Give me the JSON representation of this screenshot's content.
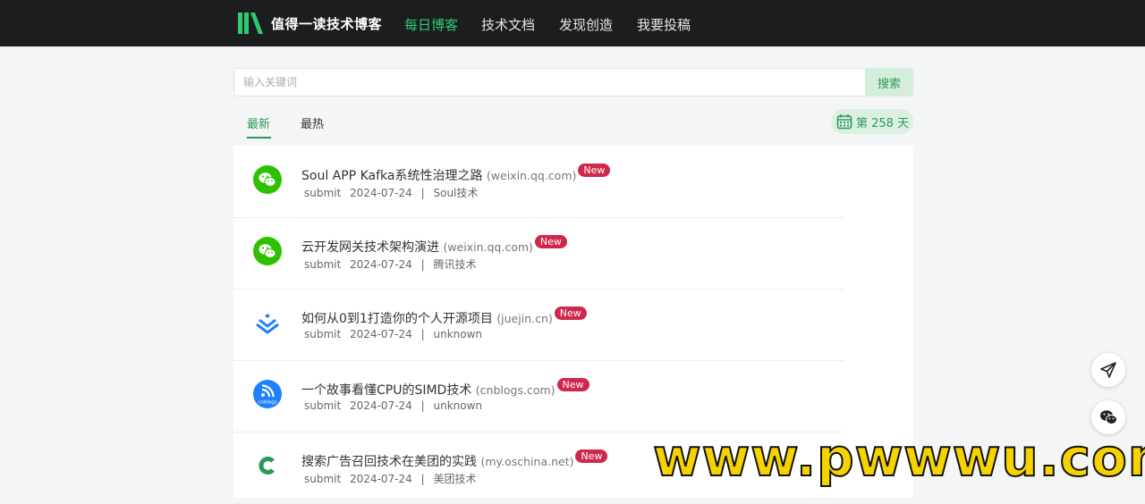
{
  "header": {
    "brand": "值得一读技术博客",
    "nav": [
      {
        "label": "每日博客",
        "active": true
      },
      {
        "label": "技术文档",
        "active": false
      },
      {
        "label": "发现创造",
        "active": false
      },
      {
        "label": "我要投稿",
        "active": false
      }
    ]
  },
  "search": {
    "placeholder": "输入关键词",
    "value": "",
    "button_label": "搜索"
  },
  "tabs": [
    {
      "label": "最新",
      "active": true
    },
    {
      "label": "最热",
      "active": false
    }
  ],
  "day_counter": "第 258 天",
  "articles": [
    {
      "icon": "wechat-icon",
      "title": "Soul APP Kafka系统性治理之路",
      "domain": "(weixin.qq.com)",
      "badge": "New",
      "author": "submit",
      "date": "2024-07-24",
      "sep": "|",
      "source": "Soul技术"
    },
    {
      "icon": "wechat-icon",
      "title": "云开发网关技术架构演进",
      "domain": "(weixin.qq.com)",
      "badge": "New",
      "author": "submit",
      "date": "2024-07-24",
      "sep": "|",
      "source": "腾讯技术"
    },
    {
      "icon": "juejin-icon",
      "title": "如何从0到1打造你的个人开源项目",
      "domain": "(juejin.cn)",
      "badge": "New",
      "author": "submit",
      "date": "2024-07-24",
      "sep": "|",
      "source": "unknown"
    },
    {
      "icon": "cnblogs-icon",
      "title": "一个故事看懂CPU的SIMD技术",
      "domain": "(cnblogs.com)",
      "badge": "New",
      "author": "submit",
      "date": "2024-07-24",
      "sep": "|",
      "source": "unknown",
      "icon_text": "cnblogs"
    },
    {
      "icon": "oschina-icon",
      "title": "搜索广告召回技术在美团的实践",
      "domain": "(my.oschina.net)",
      "badge": "New",
      "author": "submit",
      "date": "2024-07-24",
      "sep": "|",
      "source": "美团技术"
    }
  ],
  "watermark": "www.pwwwu.com",
  "colors": {
    "accent": "#2a9a57",
    "badge": "#d0284b",
    "topbar": "#1c1d1f"
  }
}
